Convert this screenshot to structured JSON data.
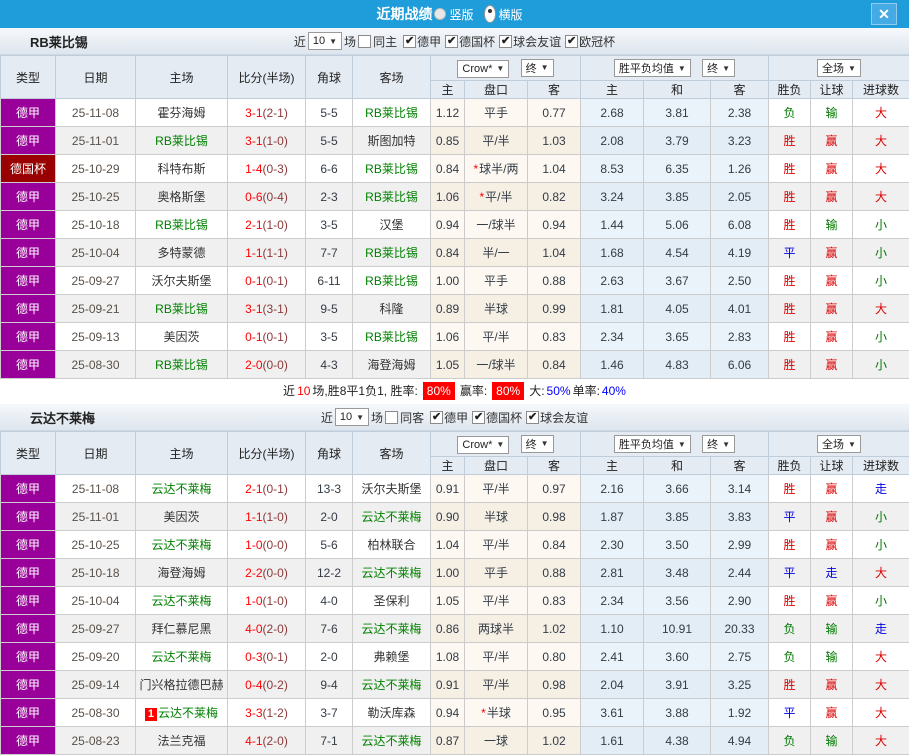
{
  "icons": {
    "arrow": "▼",
    "close": "✕",
    "check": "✔",
    "star": "*"
  },
  "colors": {
    "titlebar": "#1f9dda",
    "league_purple": "#990099",
    "cup_darkred": "#990000",
    "team_green": "#008000",
    "score_red": "#ff0000",
    "half_score": "#8b3a3a",
    "win_red": "#dd0000",
    "draw_blue": "#0000e0",
    "lose_green": "#007700",
    "rate_blue": "#0000ff",
    "badge_red": "#ff0000"
  },
  "titlebar": {
    "title": "近期战绩",
    "orientation": [
      {
        "label": "竖版",
        "selected": false
      },
      {
        "label": "横版",
        "selected": true
      }
    ]
  },
  "controls": {
    "crow": "Crow*",
    "final": "终",
    "avg": "胜平负均值",
    "fulltime": "全场"
  },
  "headers": {
    "type": "类型",
    "date": "日期",
    "home": "主场",
    "score": "比分(半场)",
    "corners": "角球",
    "away": "客场",
    "home_odds": "主",
    "handicap": "盘口",
    "away_odds": "客",
    "avg_home": "主",
    "avg_draw": "和",
    "avg_away": "客",
    "result": "胜负",
    "handicap_result": "让球",
    "goals": "进球数"
  },
  "sections": [
    {
      "team": "RB莱比锡",
      "filter": {
        "near": "近",
        "count": "10",
        "suffix": "场",
        "same_label": "同主",
        "same_checked": false,
        "leagues": [
          {
            "label": "德甲",
            "checked": true
          },
          {
            "label": "德国杯",
            "checked": true
          },
          {
            "label": "球会友谊",
            "checked": true
          },
          {
            "label": "欧冠杯",
            "checked": true
          }
        ]
      },
      "rows": [
        {
          "type": "德甲",
          "type_color": "#990099",
          "date": "25-11-08",
          "home": "霍芬海姆",
          "home_green": false,
          "score_ft": "3-1",
          "score_ht": "(2-1)",
          "corners": "5-5",
          "away": "RB莱比锡",
          "away_green": true,
          "crow_h": "1.12",
          "hcap": "平手",
          "hcap_star": false,
          "crow_a": "0.77",
          "avg_h": "2.68",
          "avg_d": "3.81",
          "avg_a": "2.38",
          "res": "负",
          "res_c": "g",
          "hres": "输",
          "hres_c": "g",
          "goals": "大",
          "goals_c": "r"
        },
        {
          "type": "德甲",
          "type_color": "#990099",
          "date": "25-11-01",
          "home": "RB莱比锡",
          "home_green": true,
          "score_ft": "3-1",
          "score_ht": "(1-0)",
          "corners": "5-5",
          "away": "斯图加特",
          "away_green": false,
          "crow_h": "0.85",
          "hcap": "平/半",
          "hcap_star": false,
          "crow_a": "1.03",
          "avg_h": "2.08",
          "avg_d": "3.79",
          "avg_a": "3.23",
          "res": "胜",
          "res_c": "r",
          "hres": "赢",
          "hres_c": "r",
          "goals": "大",
          "goals_c": "r"
        },
        {
          "type": "德国杯",
          "type_color": "#990000",
          "date": "25-10-29",
          "home": "科特布斯",
          "home_green": false,
          "score_ft": "1-4",
          "score_ht": "(0-3)",
          "corners": "6-6",
          "away": "RB莱比锡",
          "away_green": true,
          "crow_h": "0.84",
          "hcap": "球半/两",
          "hcap_star": true,
          "crow_a": "1.04",
          "avg_h": "8.53",
          "avg_d": "6.35",
          "avg_a": "1.26",
          "res": "胜",
          "res_c": "r",
          "hres": "赢",
          "hres_c": "r",
          "goals": "大",
          "goals_c": "r"
        },
        {
          "type": "德甲",
          "type_color": "#990099",
          "date": "25-10-25",
          "home": "奥格斯堡",
          "home_green": false,
          "score_ft": "0-6",
          "score_ht": "(0-4)",
          "corners": "2-3",
          "away": "RB莱比锡",
          "away_green": true,
          "crow_h": "1.06",
          "hcap": "平/半",
          "hcap_star": true,
          "crow_a": "0.82",
          "avg_h": "3.24",
          "avg_d": "3.85",
          "avg_a": "2.05",
          "res": "胜",
          "res_c": "r",
          "hres": "赢",
          "hres_c": "r",
          "goals": "大",
          "goals_c": "r"
        },
        {
          "type": "德甲",
          "type_color": "#990099",
          "date": "25-10-18",
          "home": "RB莱比锡",
          "home_green": true,
          "score_ft": "2-1",
          "score_ht": "(1-0)",
          "corners": "3-5",
          "away": "汉堡",
          "away_green": false,
          "crow_h": "0.94",
          "hcap": "一/球半",
          "hcap_star": false,
          "crow_a": "0.94",
          "avg_h": "1.44",
          "avg_d": "5.06",
          "avg_a": "6.08",
          "res": "胜",
          "res_c": "r",
          "hres": "输",
          "hres_c": "g",
          "goals": "小",
          "goals_c": "g"
        },
        {
          "type": "德甲",
          "type_color": "#990099",
          "date": "25-10-04",
          "home": "多特蒙德",
          "home_green": false,
          "score_ft": "1-1",
          "score_ht": "(1-1)",
          "corners": "7-7",
          "away": "RB莱比锡",
          "away_green": true,
          "crow_h": "0.84",
          "hcap": "半/一",
          "hcap_star": false,
          "crow_a": "1.04",
          "avg_h": "1.68",
          "avg_d": "4.54",
          "avg_a": "4.19",
          "res": "平",
          "res_c": "b",
          "hres": "赢",
          "hres_c": "r",
          "goals": "小",
          "goals_c": "g"
        },
        {
          "type": "德甲",
          "type_color": "#990099",
          "date": "25-09-27",
          "home": "沃尔夫斯堡",
          "home_green": false,
          "score_ft": "0-1",
          "score_ht": "(0-1)",
          "corners": "6-11",
          "away": "RB莱比锡",
          "away_green": true,
          "crow_h": "1.00",
          "hcap": "平手",
          "hcap_star": false,
          "crow_a": "0.88",
          "avg_h": "2.63",
          "avg_d": "3.67",
          "avg_a": "2.50",
          "res": "胜",
          "res_c": "r",
          "hres": "赢",
          "hres_c": "r",
          "goals": "小",
          "goals_c": "g"
        },
        {
          "type": "德甲",
          "type_color": "#990099",
          "date": "25-09-21",
          "home": "RB莱比锡",
          "home_green": true,
          "score_ft": "3-1",
          "score_ht": "(3-1)",
          "corners": "9-5",
          "away": "科隆",
          "away_green": false,
          "crow_h": "0.89",
          "hcap": "半球",
          "hcap_star": false,
          "crow_a": "0.99",
          "avg_h": "1.81",
          "avg_d": "4.05",
          "avg_a": "4.01",
          "res": "胜",
          "res_c": "r",
          "hres": "赢",
          "hres_c": "r",
          "goals": "大",
          "goals_c": "r"
        },
        {
          "type": "德甲",
          "type_color": "#990099",
          "date": "25-09-13",
          "home": "美因茨",
          "home_green": false,
          "score_ft": "0-1",
          "score_ht": "(0-1)",
          "corners": "3-5",
          "away": "RB莱比锡",
          "away_green": true,
          "crow_h": "1.06",
          "hcap": "平/半",
          "hcap_star": false,
          "crow_a": "0.83",
          "avg_h": "2.34",
          "avg_d": "3.65",
          "avg_a": "2.83",
          "res": "胜",
          "res_c": "r",
          "hres": "赢",
          "hres_c": "r",
          "goals": "小",
          "goals_c": "g"
        },
        {
          "type": "德甲",
          "type_color": "#990099",
          "date": "25-08-30",
          "home": "RB莱比锡",
          "home_green": true,
          "score_ft": "2-0",
          "score_ht": "(0-0)",
          "corners": "4-3",
          "away": "海登海姆",
          "away_green": false,
          "crow_h": "1.05",
          "hcap": "一/球半",
          "hcap_star": false,
          "crow_a": "0.84",
          "avg_h": "1.46",
          "avg_d": "4.83",
          "avg_a": "6.06",
          "res": "胜",
          "res_c": "r",
          "hres": "赢",
          "hres_c": "r",
          "goals": "小",
          "goals_c": "g"
        }
      ],
      "summary": {
        "near": "近",
        "count": "10",
        "text1": "场,胜8平1负1, 胜率:",
        "win_rate": "80%",
        "text2": "赢率:",
        "profit_rate": "80%",
        "text3": "大:",
        "big_pct": "50%",
        "text4": "单率:",
        "single_pct": "40%"
      }
    },
    {
      "team": "云达不莱梅",
      "filter": {
        "near": "近",
        "count": "10",
        "suffix": "场",
        "same_label": "同客",
        "same_checked": false,
        "leagues": [
          {
            "label": "德甲",
            "checked": true
          },
          {
            "label": "德国杯",
            "checked": true
          },
          {
            "label": "球会友谊",
            "checked": true
          }
        ]
      },
      "rows": [
        {
          "type": "德甲",
          "type_color": "#990099",
          "date": "25-11-08",
          "home": "云达不莱梅",
          "home_green": true,
          "score_ft": "2-1",
          "score_ht": "(0-1)",
          "corners": "13-3",
          "away": "沃尔夫斯堡",
          "away_green": false,
          "crow_h": "0.91",
          "hcap": "平/半",
          "hcap_star": false,
          "crow_a": "0.97",
          "avg_h": "2.16",
          "avg_d": "3.66",
          "avg_a": "3.14",
          "res": "胜",
          "res_c": "r",
          "hres": "赢",
          "hres_c": "r",
          "goals": "走",
          "goals_c": "b"
        },
        {
          "type": "德甲",
          "type_color": "#990099",
          "date": "25-11-01",
          "home": "美因茨",
          "home_green": false,
          "score_ft": "1-1",
          "score_ht": "(1-0)",
          "corners": "2-0",
          "away": "云达不莱梅",
          "away_green": true,
          "crow_h": "0.90",
          "hcap": "半球",
          "hcap_star": false,
          "crow_a": "0.98",
          "avg_h": "1.87",
          "avg_d": "3.85",
          "avg_a": "3.83",
          "res": "平",
          "res_c": "b",
          "hres": "赢",
          "hres_c": "r",
          "goals": "小",
          "goals_c": "g"
        },
        {
          "type": "德甲",
          "type_color": "#990099",
          "date": "25-10-25",
          "home": "云达不莱梅",
          "home_green": true,
          "score_ft": "1-0",
          "score_ht": "(0-0)",
          "corners": "5-6",
          "away": "柏林联合",
          "away_green": false,
          "crow_h": "1.04",
          "hcap": "平/半",
          "hcap_star": false,
          "crow_a": "0.84",
          "avg_h": "2.30",
          "avg_d": "3.50",
          "avg_a": "2.99",
          "res": "胜",
          "res_c": "r",
          "hres": "赢",
          "hres_c": "r",
          "goals": "小",
          "goals_c": "g"
        },
        {
          "type": "德甲",
          "type_color": "#990099",
          "date": "25-10-18",
          "home": "海登海姆",
          "home_green": false,
          "score_ft": "2-2",
          "score_ht": "(0-0)",
          "corners": "12-2",
          "away": "云达不莱梅",
          "away_green": true,
          "crow_h": "1.00",
          "hcap": "平手",
          "hcap_star": false,
          "crow_a": "0.88",
          "avg_h": "2.81",
          "avg_d": "3.48",
          "avg_a": "2.44",
          "res": "平",
          "res_c": "b",
          "hres": "走",
          "hres_c": "b",
          "goals": "大",
          "goals_c": "r"
        },
        {
          "type": "德甲",
          "type_color": "#990099",
          "date": "25-10-04",
          "home": "云达不莱梅",
          "home_green": true,
          "score_ft": "1-0",
          "score_ht": "(1-0)",
          "corners": "4-0",
          "away": "圣保利",
          "away_green": false,
          "crow_h": "1.05",
          "hcap": "平/半",
          "hcap_star": false,
          "crow_a": "0.83",
          "avg_h": "2.34",
          "avg_d": "3.56",
          "avg_a": "2.90",
          "res": "胜",
          "res_c": "r",
          "hres": "赢",
          "hres_c": "r",
          "goals": "小",
          "goals_c": "g"
        },
        {
          "type": "德甲",
          "type_color": "#990099",
          "date": "25-09-27",
          "home": "拜仁慕尼黑",
          "home_green": false,
          "score_ft": "4-0",
          "score_ht": "(2-0)",
          "corners": "7-6",
          "away": "云达不莱梅",
          "away_green": true,
          "crow_h": "0.86",
          "hcap": "两球半",
          "hcap_star": false,
          "crow_a": "1.02",
          "avg_h": "1.10",
          "avg_d": "10.91",
          "avg_a": "20.33",
          "res": "负",
          "res_c": "g",
          "hres": "输",
          "hres_c": "g",
          "goals": "走",
          "goals_c": "b"
        },
        {
          "type": "德甲",
          "type_color": "#990099",
          "date": "25-09-20",
          "home": "云达不莱梅",
          "home_green": true,
          "score_ft": "0-3",
          "score_ht": "(0-1)",
          "corners": "2-0",
          "away": "弗赖堡",
          "away_green": false,
          "crow_h": "1.08",
          "hcap": "平/半",
          "hcap_star": false,
          "crow_a": "0.80",
          "avg_h": "2.41",
          "avg_d": "3.60",
          "avg_a": "2.75",
          "res": "负",
          "res_c": "g",
          "hres": "输",
          "hres_c": "g",
          "goals": "大",
          "goals_c": "r"
        },
        {
          "type": "德甲",
          "type_color": "#990099",
          "date": "25-09-14",
          "home": "门兴格拉德巴赫",
          "home_green": false,
          "score_ft": "0-4",
          "score_ht": "(0-2)",
          "corners": "9-4",
          "away": "云达不莱梅",
          "away_green": true,
          "crow_h": "0.91",
          "hcap": "平/半",
          "hcap_star": false,
          "crow_a": "0.98",
          "avg_h": "2.04",
          "avg_d": "3.91",
          "avg_a": "3.25",
          "res": "胜",
          "res_c": "r",
          "hres": "赢",
          "hres_c": "r",
          "goals": "大",
          "goals_c": "r"
        },
        {
          "type": "德甲",
          "type_color": "#990099",
          "date": "25-08-30",
          "home": "云达不莱梅",
          "home_green": true,
          "badge": "1",
          "score_ft": "3-3",
          "score_ht": "(1-2)",
          "corners": "3-7",
          "away": "勒沃库森",
          "away_green": false,
          "crow_h": "0.94",
          "hcap": "半球",
          "hcap_star": true,
          "crow_a": "0.95",
          "avg_h": "3.61",
          "avg_d": "3.88",
          "avg_a": "1.92",
          "res": "平",
          "res_c": "b",
          "hres": "赢",
          "hres_c": "r",
          "goals": "大",
          "goals_c": "r"
        },
        {
          "type": "德甲",
          "type_color": "#990099",
          "date": "25-08-23",
          "home": "法兰克福",
          "home_green": false,
          "score_ft": "4-1",
          "score_ht": "(2-0)",
          "corners": "7-1",
          "away": "云达不莱梅",
          "away_green": true,
          "crow_h": "0.87",
          "hcap": "一球",
          "hcap_star": false,
          "crow_a": "1.02",
          "avg_h": "1.61",
          "avg_d": "4.38",
          "avg_a": "4.94",
          "res": "负",
          "res_c": "g",
          "hres": "输",
          "hres_c": "g",
          "goals": "大",
          "goals_c": "r"
        }
      ]
    }
  ]
}
